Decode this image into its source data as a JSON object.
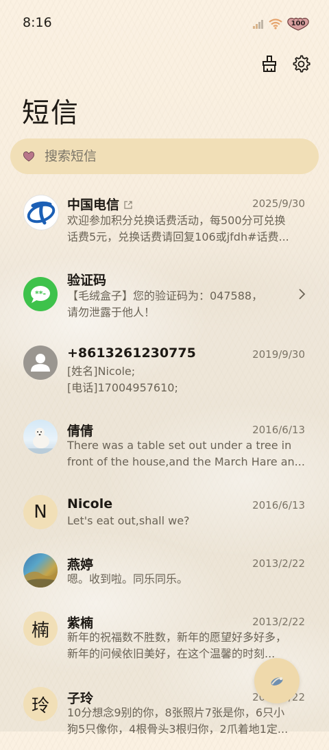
{
  "status_bar": {
    "time": "8:16",
    "battery": "100"
  },
  "header": {
    "title": "短信"
  },
  "search": {
    "placeholder": "搜索短信"
  },
  "messages": [
    {
      "sender": "中国电信",
      "date": "2025/9/30",
      "line1": "欢迎参加积分兑换话费活动，每500分可兑换",
      "line2": "话费5元，兑换话费请回复106或jfdh#话费..."
    },
    {
      "sender": "验证码",
      "date": "",
      "line1": "【毛绒盒子】您的验证码为：047588，",
      "line2": "请勿泄露于他人！"
    },
    {
      "sender": "+8613261230775",
      "date": "2019/9/30",
      "line1": "[姓名]Nicole;",
      "line2": "[电话]17004957610;"
    },
    {
      "sender": "倩倩",
      "date": "2016/6/13",
      "line1": "There was a table set out under a tree in",
      "line2": "front of the house,and the March Hare an..."
    },
    {
      "sender": "Nicole",
      "avatar_letter": "N",
      "date": "2016/6/13",
      "line1": "Let's eat out,shall we?",
      "line2": ""
    },
    {
      "sender": "燕婷",
      "date": "2013/2/22",
      "line1": "嗯。收到啦。同乐同乐。",
      "line2": ""
    },
    {
      "sender": "紫楠",
      "avatar_letter": "楠",
      "date": "2013/2/22",
      "line1": "新年的祝福数不胜数，新年的愿望好多好多，",
      "line2": "新年的问候依旧美好，在这个温馨的时刻..."
    },
    {
      "sender": "子玲",
      "avatar_letter": "玲",
      "date": "2013/2/22",
      "line1": "10分想念9别的你，8张照片7张是你，6只小",
      "line2": "狗5只像你，4根骨头3根归你，2爪着地1定..."
    }
  ],
  "colors": {
    "accent": "#f1dfb7",
    "title": "#1d1914",
    "secondary": "#7b7466"
  },
  "icons": [
    "signal-icon",
    "wifi-icon",
    "battery-icon",
    "clean-brush-icon",
    "settings-gear-icon",
    "heart-icon",
    "chevron-right-icon",
    "external-link-icon",
    "fab-compose-icon"
  ]
}
